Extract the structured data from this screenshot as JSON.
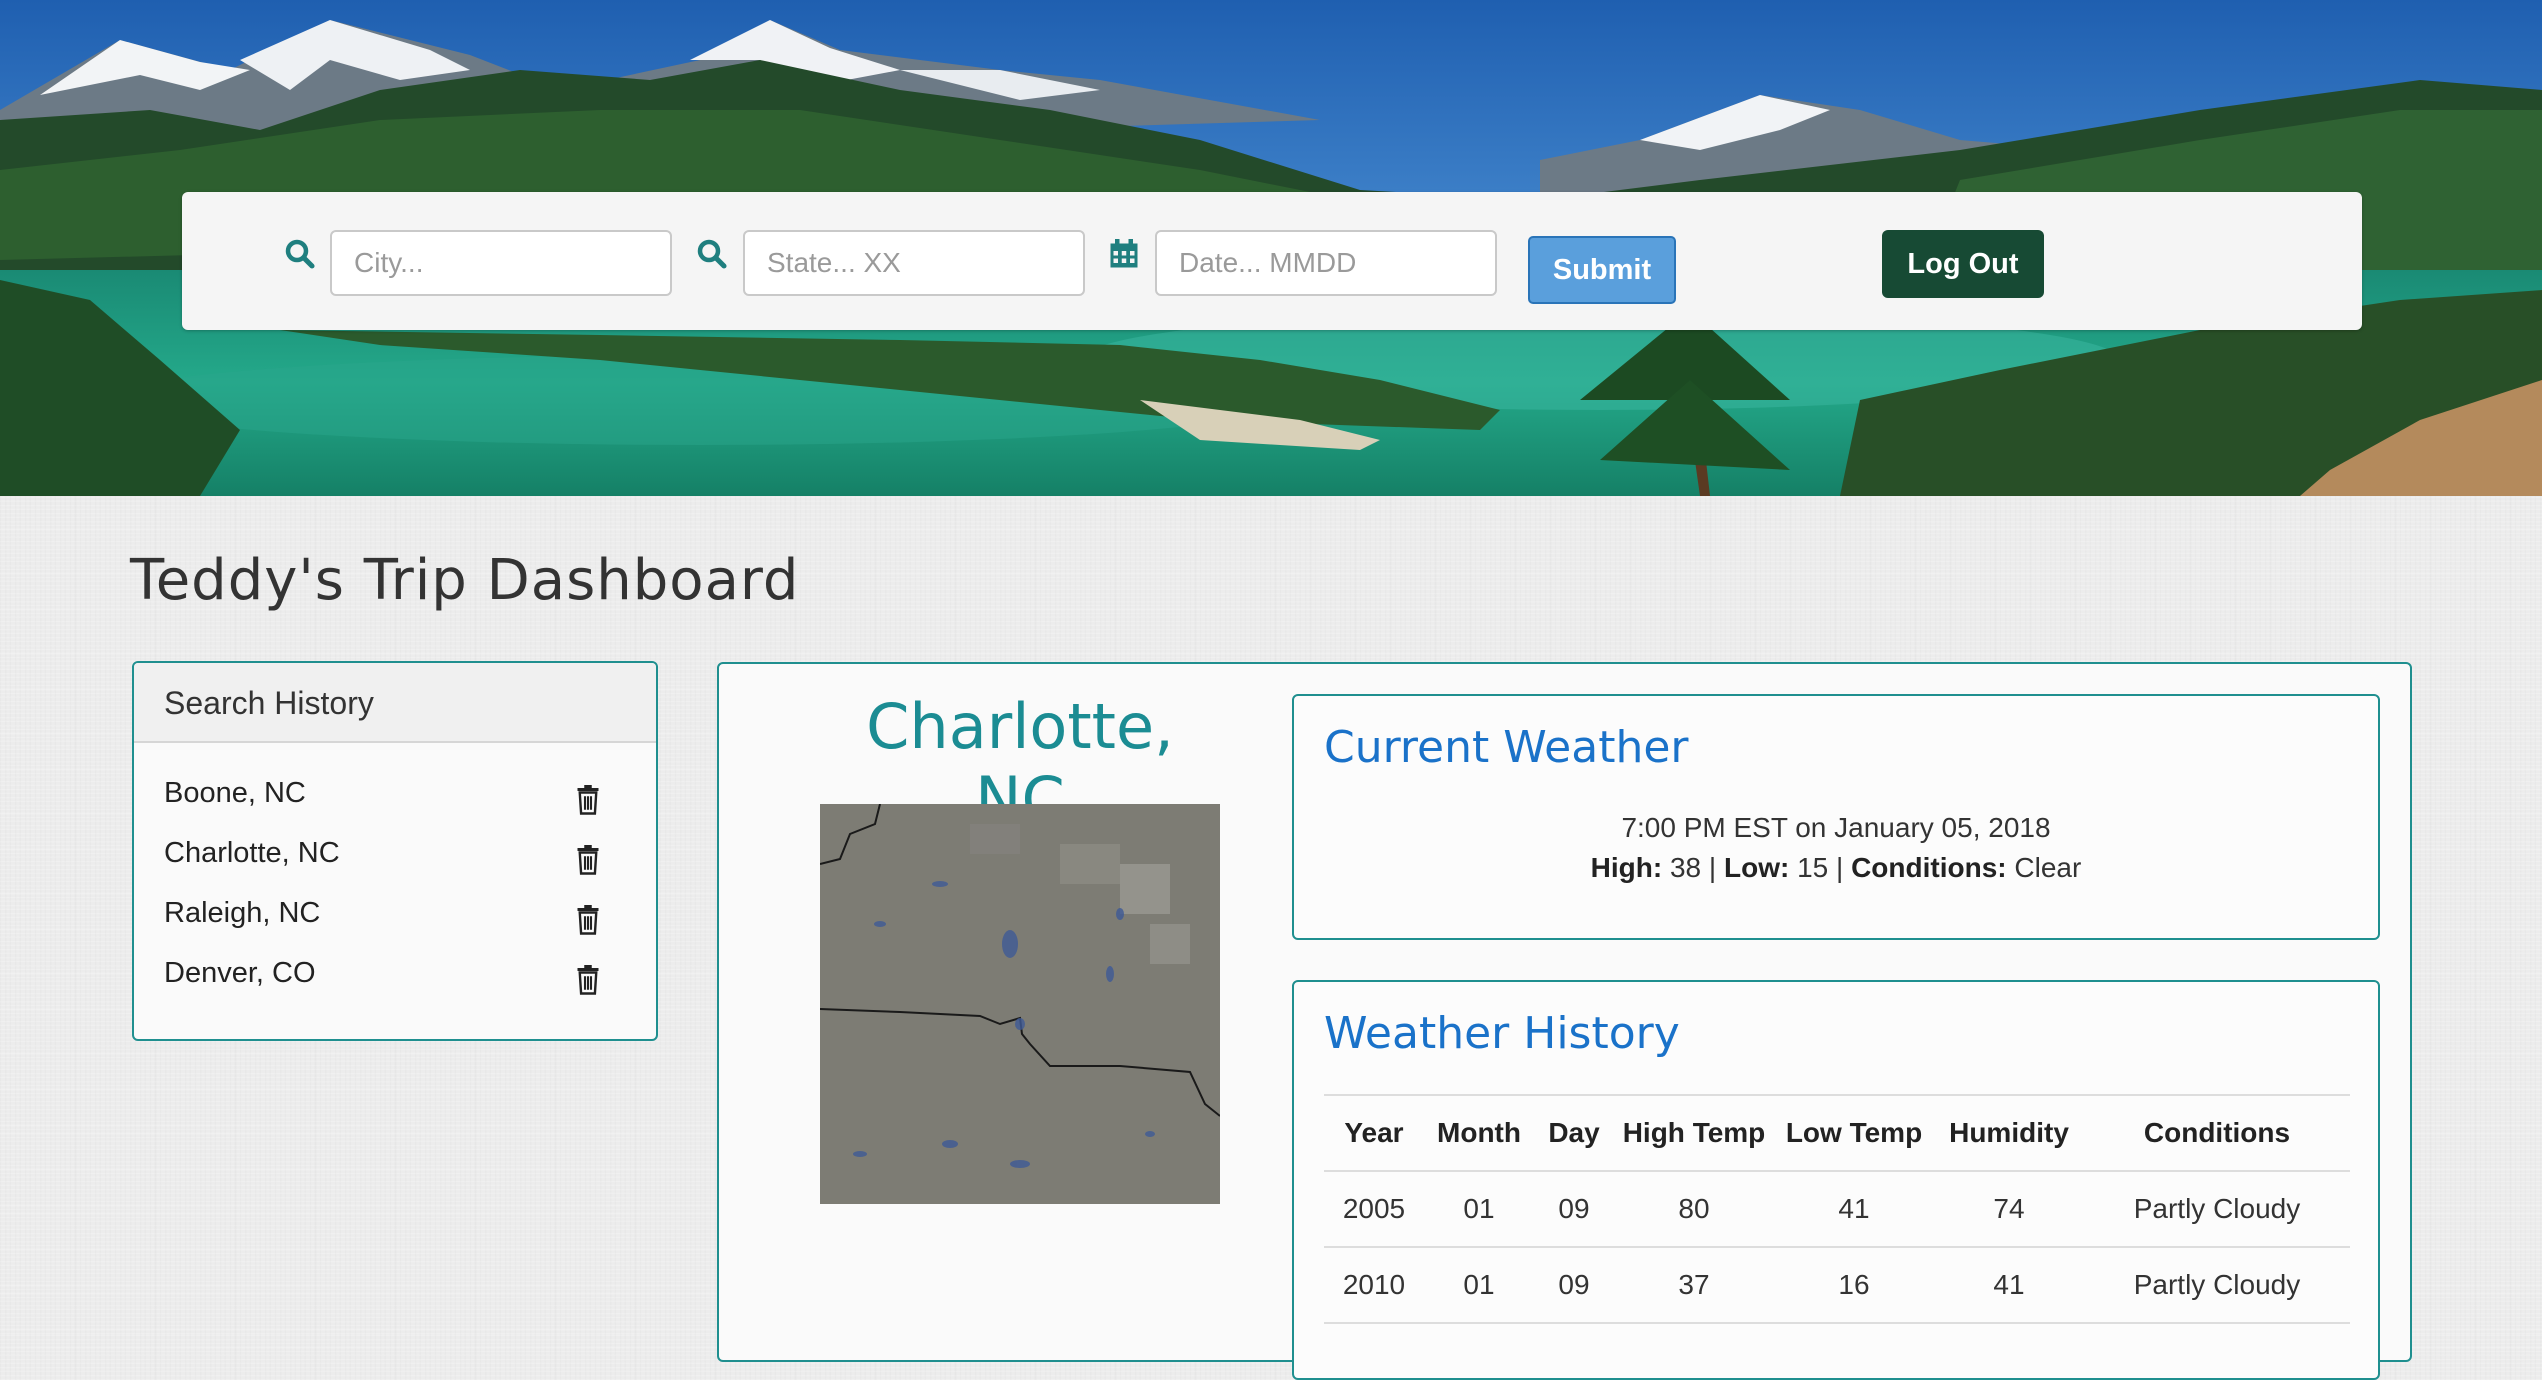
{
  "search": {
    "city_placeholder": "City...",
    "state_placeholder": "State... XX",
    "date_placeholder": "Date... MMDD",
    "submit_label": "Submit",
    "logout_label": "Log Out",
    "icons": [
      "search-icon",
      "search-icon",
      "calendar-icon"
    ]
  },
  "page_title": "Teddy's Trip Dashboard",
  "history": {
    "heading": "Search History",
    "items": [
      {
        "label": "Boone, NC"
      },
      {
        "label": "Charlotte, NC"
      },
      {
        "label": "Raleigh, NC"
      },
      {
        "label": "Denver, CO"
      }
    ]
  },
  "location": {
    "city_title": "Charlotte, NC"
  },
  "current_weather": {
    "title": "Current Weather",
    "timestamp": "7:00 PM EST on January 05, 2018",
    "high_label": "High:",
    "high": "38",
    "low_label": "Low:",
    "low": "15",
    "conditions_label": "Conditions:",
    "conditions": "Clear",
    "separator": "|"
  },
  "weather_history": {
    "title": "Weather History",
    "headers": [
      "Year",
      "Month",
      "Day",
      "High Temp",
      "Low Temp",
      "Humidity",
      "Conditions"
    ],
    "rows": [
      [
        "2005",
        "01",
        "09",
        "80",
        "41",
        "74",
        "Partly Cloudy"
      ],
      [
        "2010",
        "01",
        "09",
        "37",
        "16",
        "41",
        "Partly Cloudy"
      ]
    ]
  },
  "colors": {
    "accent_teal": "#1f8f8f",
    "title_teal": "#1b8c93",
    "heading_blue": "#1a72c9",
    "submit_blue": "#5a9fdc",
    "logout_green": "#174a34"
  }
}
